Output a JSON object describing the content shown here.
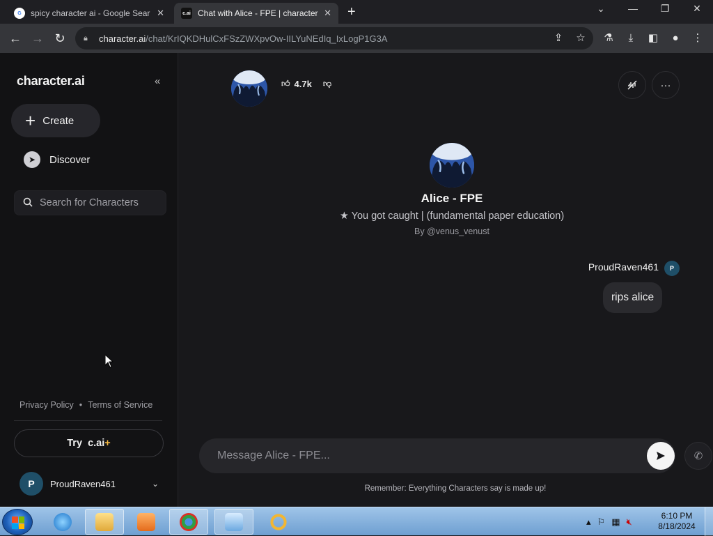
{
  "browser": {
    "tabs": [
      {
        "title": "spicy character ai - Google Sear",
        "favicon": "google-icon"
      },
      {
        "title": "Chat with Alice - FPE | character.",
        "favicon": "character-ai-icon",
        "favicon_text": "c.ai"
      }
    ],
    "url_host": "character.ai",
    "url_path": "/chat/KrIQKDHulCxFSzZWXpvOw-IILYuNEdIq_IxLogP1G3A"
  },
  "sidebar": {
    "brand": "character.ai",
    "create_label": "Create",
    "discover_label": "Discover",
    "search_placeholder": "Search for Characters",
    "privacy_policy": "Privacy Policy",
    "separator": "•",
    "terms": "Terms of Service",
    "try_label": "Try",
    "try_brand": "c.ai",
    "try_plus": "+",
    "user_initial": "P",
    "username": "ProudRaven461"
  },
  "chat": {
    "likes": "4.7k",
    "character_name": "Alice - FPE",
    "tagline": "★ You got caught | (fundamental paper education)",
    "creator": "By @venus_venust",
    "messages": [
      {
        "author": "ProudRaven461",
        "author_initial": "P",
        "text": "rips alice"
      }
    ],
    "composer_placeholder": "Message Alice - FPE...",
    "disclaimer": "Remember: Everything Characters say is made up!"
  },
  "taskbar": {
    "time": "6:10 PM",
    "date": "8/18/2024"
  },
  "colors": {
    "accent_plus": "#f5b942",
    "user_avatar": "#1f4f68"
  }
}
